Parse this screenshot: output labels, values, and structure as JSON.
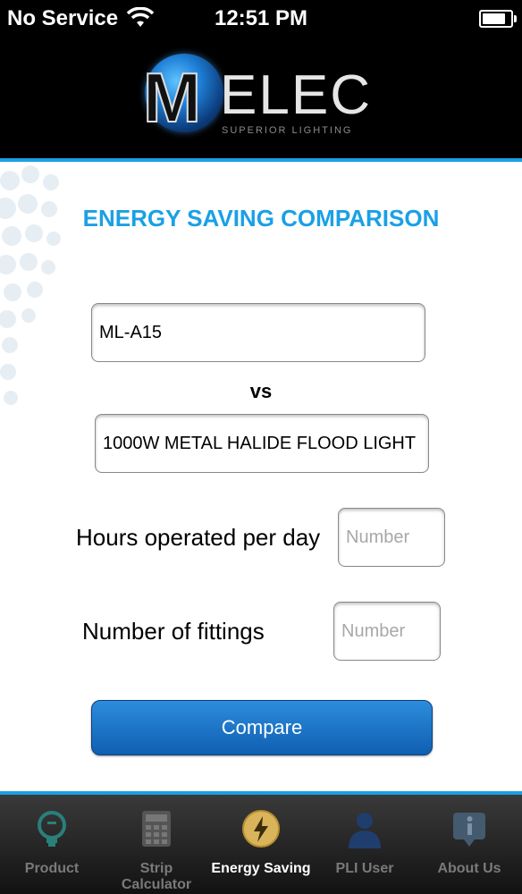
{
  "status": {
    "carrier": "No Service",
    "time": "12:51 PM",
    "battery_level": 0.9
  },
  "header": {
    "logo_text": "ELEC",
    "logo_m": "M",
    "logo_sub": "SUPERIOR LIGHTING"
  },
  "main": {
    "title": "ENERGY SAVING COMPARISON",
    "product_a": "ML-A15",
    "vs": "vs",
    "product_b": "1000W METAL HALIDE FLOOD LIGHT",
    "hours_label": "Hours operated per day",
    "hours_placeholder": "Number",
    "fittings_label": "Number of fittings",
    "fittings_placeholder": "Number",
    "compare_label": "Compare"
  },
  "tabs": [
    {
      "label": "Product",
      "icon": "product-icon",
      "active": false
    },
    {
      "label": "Strip Calculator",
      "icon": "calculator-icon",
      "active": false
    },
    {
      "label": "Energy Saving",
      "icon": "lightning-icon",
      "active": true
    },
    {
      "label": "PLI User",
      "icon": "user-icon",
      "active": false
    },
    {
      "label": "About Us",
      "icon": "info-icon",
      "active": false
    }
  ],
  "colors": {
    "accent": "#1aa0e6",
    "button": "#1466bb"
  }
}
